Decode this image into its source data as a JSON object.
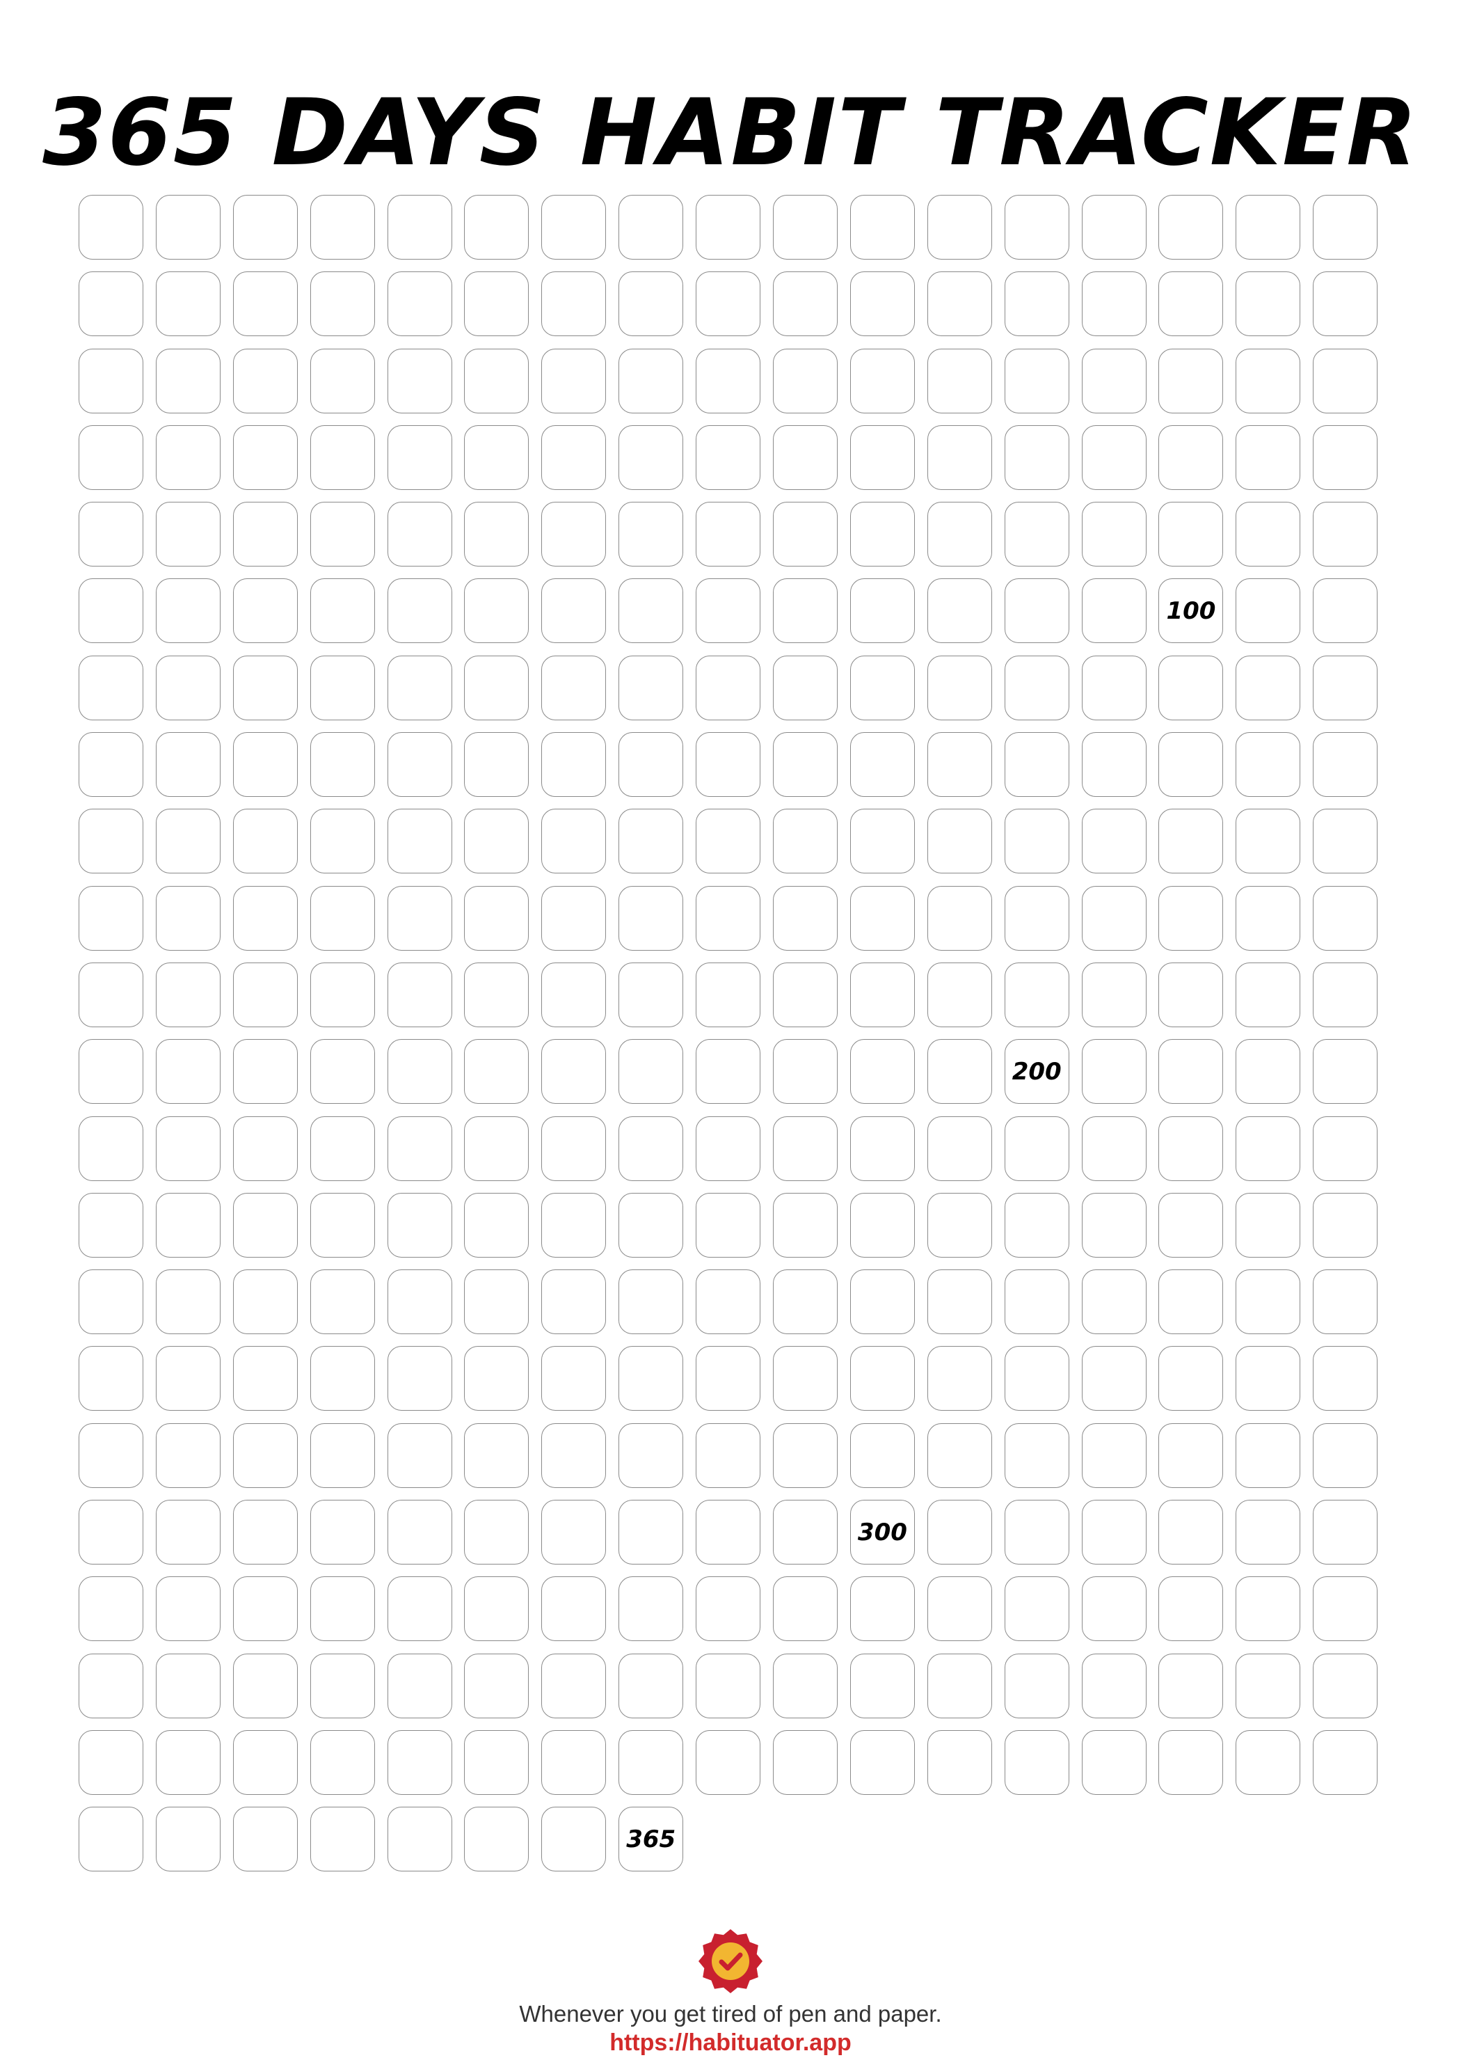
{
  "title": "365 DAYS HABIT TRACKER",
  "tracker": {
    "total_days": 365,
    "columns": 17,
    "labels": [
      {
        "day": 100,
        "text": "100"
      },
      {
        "day": 200,
        "text": "200"
      },
      {
        "day": 300,
        "text": "300"
      },
      {
        "day": 365,
        "text": "365"
      }
    ]
  },
  "footer": {
    "logo_icon": "badge-check-icon",
    "tagline": "Whenever you get tired of pen and paper.",
    "link_text": "https://habituator.app"
  },
  "colors": {
    "box_border": "#8a8a8a",
    "link": "#d22b2b",
    "badge_red": "#c8202f",
    "badge_gold": "#f2b631"
  }
}
